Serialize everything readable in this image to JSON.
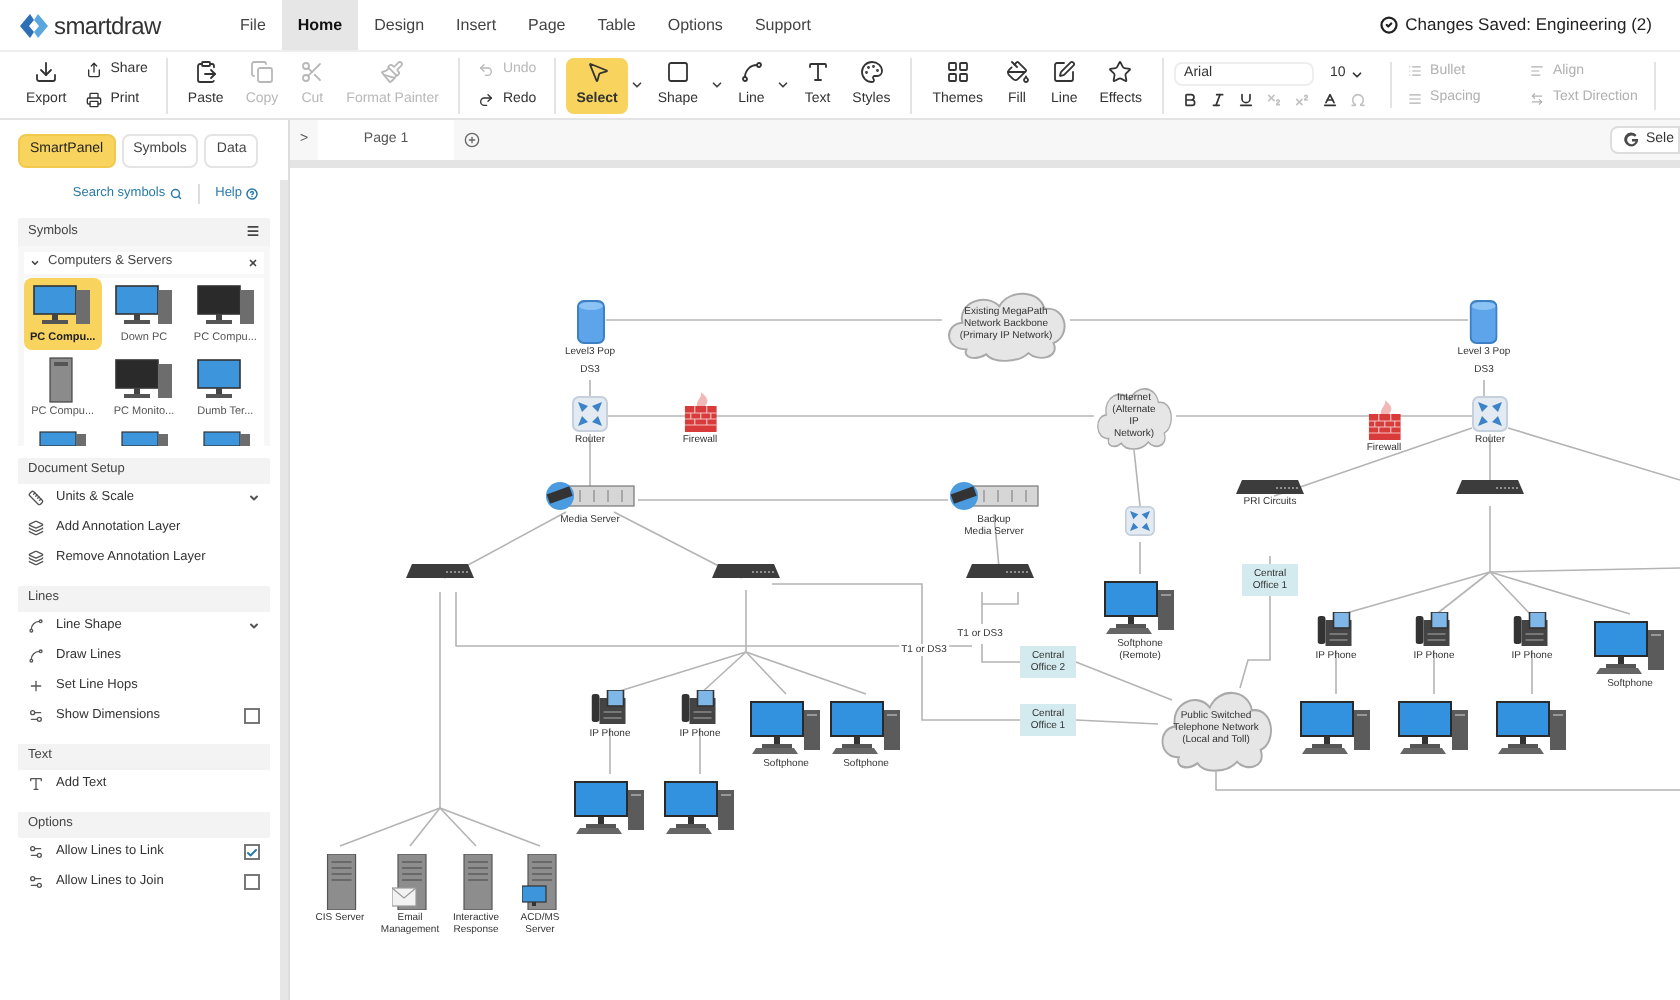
{
  "app": {
    "logo": "smartdraw",
    "save_status": "Changes Saved: Engineering (2)"
  },
  "menu": [
    {
      "label": "File",
      "selected": false
    },
    {
      "label": "Home",
      "selected": true
    },
    {
      "label": "Design",
      "selected": false
    },
    {
      "label": "Insert",
      "selected": false
    },
    {
      "label": "Page",
      "selected": false
    },
    {
      "label": "Table",
      "selected": false
    },
    {
      "label": "Options",
      "selected": false
    },
    {
      "label": "Support",
      "selected": false
    }
  ],
  "toolbar": {
    "groups": [
      {
        "items": [
          {
            "label": "Export",
            "kind": "big",
            "disabled": false
          },
          {
            "label": "Share",
            "kind": "small",
            "disabled": false
          },
          {
            "label": "Print",
            "kind": "small",
            "disabled": false
          }
        ]
      },
      {
        "items": [
          {
            "label": "Paste",
            "kind": "big",
            "disabled": false
          },
          {
            "label": "Copy",
            "kind": "big",
            "disabled": true
          },
          {
            "label": "Cut",
            "kind": "big",
            "disabled": true
          },
          {
            "label": "Format Painter",
            "kind": "big",
            "disabled": true
          }
        ]
      },
      {
        "items": [
          {
            "label": "Undo",
            "kind": "small",
            "disabled": true
          },
          {
            "label": "Redo",
            "kind": "small",
            "disabled": false
          }
        ]
      },
      {
        "items": [
          {
            "label": "Select",
            "kind": "big",
            "disabled": false,
            "selected": true,
            "dropdown": true
          },
          {
            "label": "Shape",
            "kind": "big",
            "disabled": false,
            "selected": false,
            "dropdown": true
          },
          {
            "label": "Line",
            "kind": "big",
            "disabled": false,
            "selected": false,
            "dropdown": true
          },
          {
            "label": "Text",
            "kind": "big",
            "disabled": false,
            "selected": false,
            "dropdown": false
          },
          {
            "label": "Styles",
            "kind": "big",
            "disabled": false,
            "selected": false,
            "dropdown": false
          }
        ]
      },
      {
        "items": [
          {
            "label": "Themes",
            "kind": "big",
            "disabled": false
          },
          {
            "label": "Fill",
            "kind": "big",
            "disabled": false
          },
          {
            "label": "Line",
            "kind": "big",
            "disabled": false
          },
          {
            "label": "Effects",
            "kind": "big",
            "disabled": false
          }
        ]
      }
    ],
    "font": {
      "family": "Arial",
      "size": "10"
    },
    "format_buttons": [
      {
        "disabled": false
      },
      {
        "disabled": false
      },
      {
        "disabled": false
      },
      {
        "disabled": true
      },
      {
        "disabled": true
      },
      {
        "disabled": false
      },
      {
        "disabled": true
      }
    ],
    "paragraph": [
      {
        "label": "Bullet",
        "disabled": true
      },
      {
        "label": "Align",
        "disabled": true
      },
      {
        "label": "Spacing",
        "disabled": true
      },
      {
        "label": "Text Direction",
        "disabled": true
      }
    ]
  },
  "panel": {
    "tabs": [
      {
        "label": "SmartPanel",
        "selected": true
      },
      {
        "label": "Symbols",
        "selected": false
      },
      {
        "label": "Data",
        "selected": false
      }
    ],
    "links": [
      {
        "label": "Search symbols"
      },
      {
        "label": "Help"
      }
    ],
    "symbols": {
      "title": "Symbols",
      "library": "Computers & Servers",
      "items": [
        {
          "label": "PC Compu...",
          "selected": true
        },
        {
          "label": "Down PC",
          "selected": false
        },
        {
          "label": "PC Compu...",
          "selected": false
        },
        {
          "label": "PC Compu...",
          "selected": false
        },
        {
          "label": "PC Monito...",
          "selected": false
        },
        {
          "label": "Dumb Ter...",
          "selected": false
        }
      ]
    },
    "sections": [
      {
        "title": "Document Setup",
        "items": [
          {
            "label": "Units & Scale",
            "kind": "dropdown"
          },
          {
            "label": "Add Annotation Layer",
            "kind": "action"
          },
          {
            "label": "Remove Annotation Layer",
            "kind": "action"
          }
        ]
      },
      {
        "title": "Lines",
        "items": [
          {
            "label": "Line Shape",
            "kind": "dropdown"
          },
          {
            "label": "Draw Lines",
            "kind": "action"
          },
          {
            "label": "Set Line Hops",
            "kind": "action"
          },
          {
            "label": "Show Dimensions",
            "kind": "checkbox",
            "checked": false
          }
        ]
      },
      {
        "title": "Text",
        "items": [
          {
            "label": "Add Text",
            "kind": "action"
          }
        ]
      },
      {
        "title": "Options",
        "items": [
          {
            "label": "Allow Lines to Link",
            "kind": "checkbox",
            "checked": true
          },
          {
            "label": "Allow Lines to Join",
            "kind": "checkbox",
            "checked": false
          }
        ]
      }
    ]
  },
  "page_bar": {
    "toggle": ">",
    "tabs": [
      {
        "label": "Page 1",
        "selected": true
      }
    ],
    "right_button": "Sele"
  },
  "diagram": {
    "nodes": [
      {
        "kind": "pop",
        "label": "Level3 Pop",
        "sublabel": "DS3"
      },
      {
        "kind": "cloud",
        "label": "Existing MegaPath Network Backbone (Primary IP Network)"
      },
      {
        "kind": "pop",
        "label": "Level 3 Pop",
        "sublabel": "DS3"
      },
      {
        "kind": "router",
        "label": "Router"
      },
      {
        "kind": "firewall",
        "label": "Firewall"
      },
      {
        "kind": "cloud",
        "label": "Internet (Alternate IP Network)"
      },
      {
        "kind": "firewall",
        "label": "Firewall"
      },
      {
        "kind": "router",
        "label": "Router"
      },
      {
        "kind": "rack-server",
        "label": "Media Server"
      },
      {
        "kind": "rack-server",
        "label": "Backup Media Server"
      },
      {
        "kind": "router"
      },
      {
        "kind": "switch"
      },
      {
        "kind": "switch"
      },
      {
        "kind": "switch"
      },
      {
        "kind": "switch",
        "label": "PRI Circuits"
      },
      {
        "kind": "switch"
      },
      {
        "kind": "pc",
        "label": "Softphone (Remote)"
      },
      {
        "kind": "office",
        "label": "Central Office 1"
      },
      {
        "kind": "office",
        "label": "Central Office 2"
      },
      {
        "kind": "office",
        "label": "Central Office 1"
      },
      {
        "kind": "cloud",
        "label": "Public Switched Telephone Network (Local and Toll)"
      },
      {
        "kind": "phone",
        "label": "IP Phone"
      },
      {
        "kind": "phone",
        "label": "IP Phone"
      },
      {
        "kind": "pc",
        "label": "Softphone"
      },
      {
        "kind": "pc",
        "label": "Softphone"
      },
      {
        "kind": "pc"
      },
      {
        "kind": "pc"
      },
      {
        "kind": "server",
        "label": "CIS Server"
      },
      {
        "kind": "mail-server",
        "label": "Email Management"
      },
      {
        "kind": "server",
        "label": "Interactive Response"
      },
      {
        "kind": "terminal-server",
        "label": "ACD/MS Server"
      },
      {
        "kind": "phone",
        "label": "IP Phone"
      },
      {
        "kind": "phone",
        "label": "IP Phone"
      },
      {
        "kind": "phone",
        "label": "IP Phone"
      },
      {
        "kind": "pc",
        "label": "Softphone"
      },
      {
        "kind": "pc"
      },
      {
        "kind": "pc"
      },
      {
        "kind": "pc"
      }
    ],
    "notes": [
      {
        "label": "T1 or DS3"
      },
      {
        "label": "T1 or DS3"
      }
    ]
  }
}
